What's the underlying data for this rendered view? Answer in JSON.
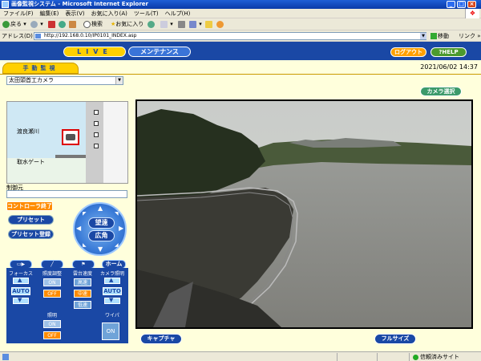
{
  "window": {
    "title": "画像監視システム - Microsoft Internet Explorer"
  },
  "menu": [
    "ファイル(F)",
    "編集(E)",
    "表示(V)",
    "お気に入り(A)",
    "ツール(T)",
    "ヘルプ(H)"
  ],
  "toolbar": {
    "back": "戻る",
    "search": "検索",
    "favorites": "お気に入り"
  },
  "address": {
    "label": "アドレス(D)",
    "url": "http://192.168.0.10/IP0101_INDEX.asp",
    "go": "移動",
    "links": "リンク"
  },
  "nav": {
    "live": "LIVE",
    "maintenance": "メンテナンス",
    "logout": "ログアウト",
    "help": "?HELP"
  },
  "tab": {
    "manual": "手動監視"
  },
  "datetime": "2021/06/02 14:37",
  "camera_select": {
    "value": "太田頭首工カメラ"
  },
  "map": {
    "river": "渡良瀬川",
    "gate": "取水ゲート"
  },
  "control": {
    "label": "制御元",
    "end": "コントローラ終了",
    "preset": "プリセット",
    "preset_register": "プリセット登録",
    "tele": "望遠",
    "wide": "広角",
    "home": "ホーム"
  },
  "panel": {
    "focus": "フォーカス",
    "brightness": "照度調整",
    "speed": "雲台速度",
    "iris": "カメラ照明",
    "lighting": "照明",
    "wiper": "ワイパ",
    "auto": "AUTO",
    "on": "ON",
    "off": "OFF",
    "fast": "高速",
    "mid": "中速",
    "slow": "低速"
  },
  "buttons": {
    "camera_select": "カメラ選択",
    "capture": "キャプチャ",
    "fullsize": "フルサイズ"
  },
  "status": {
    "zone": "信頼済みサイト"
  }
}
